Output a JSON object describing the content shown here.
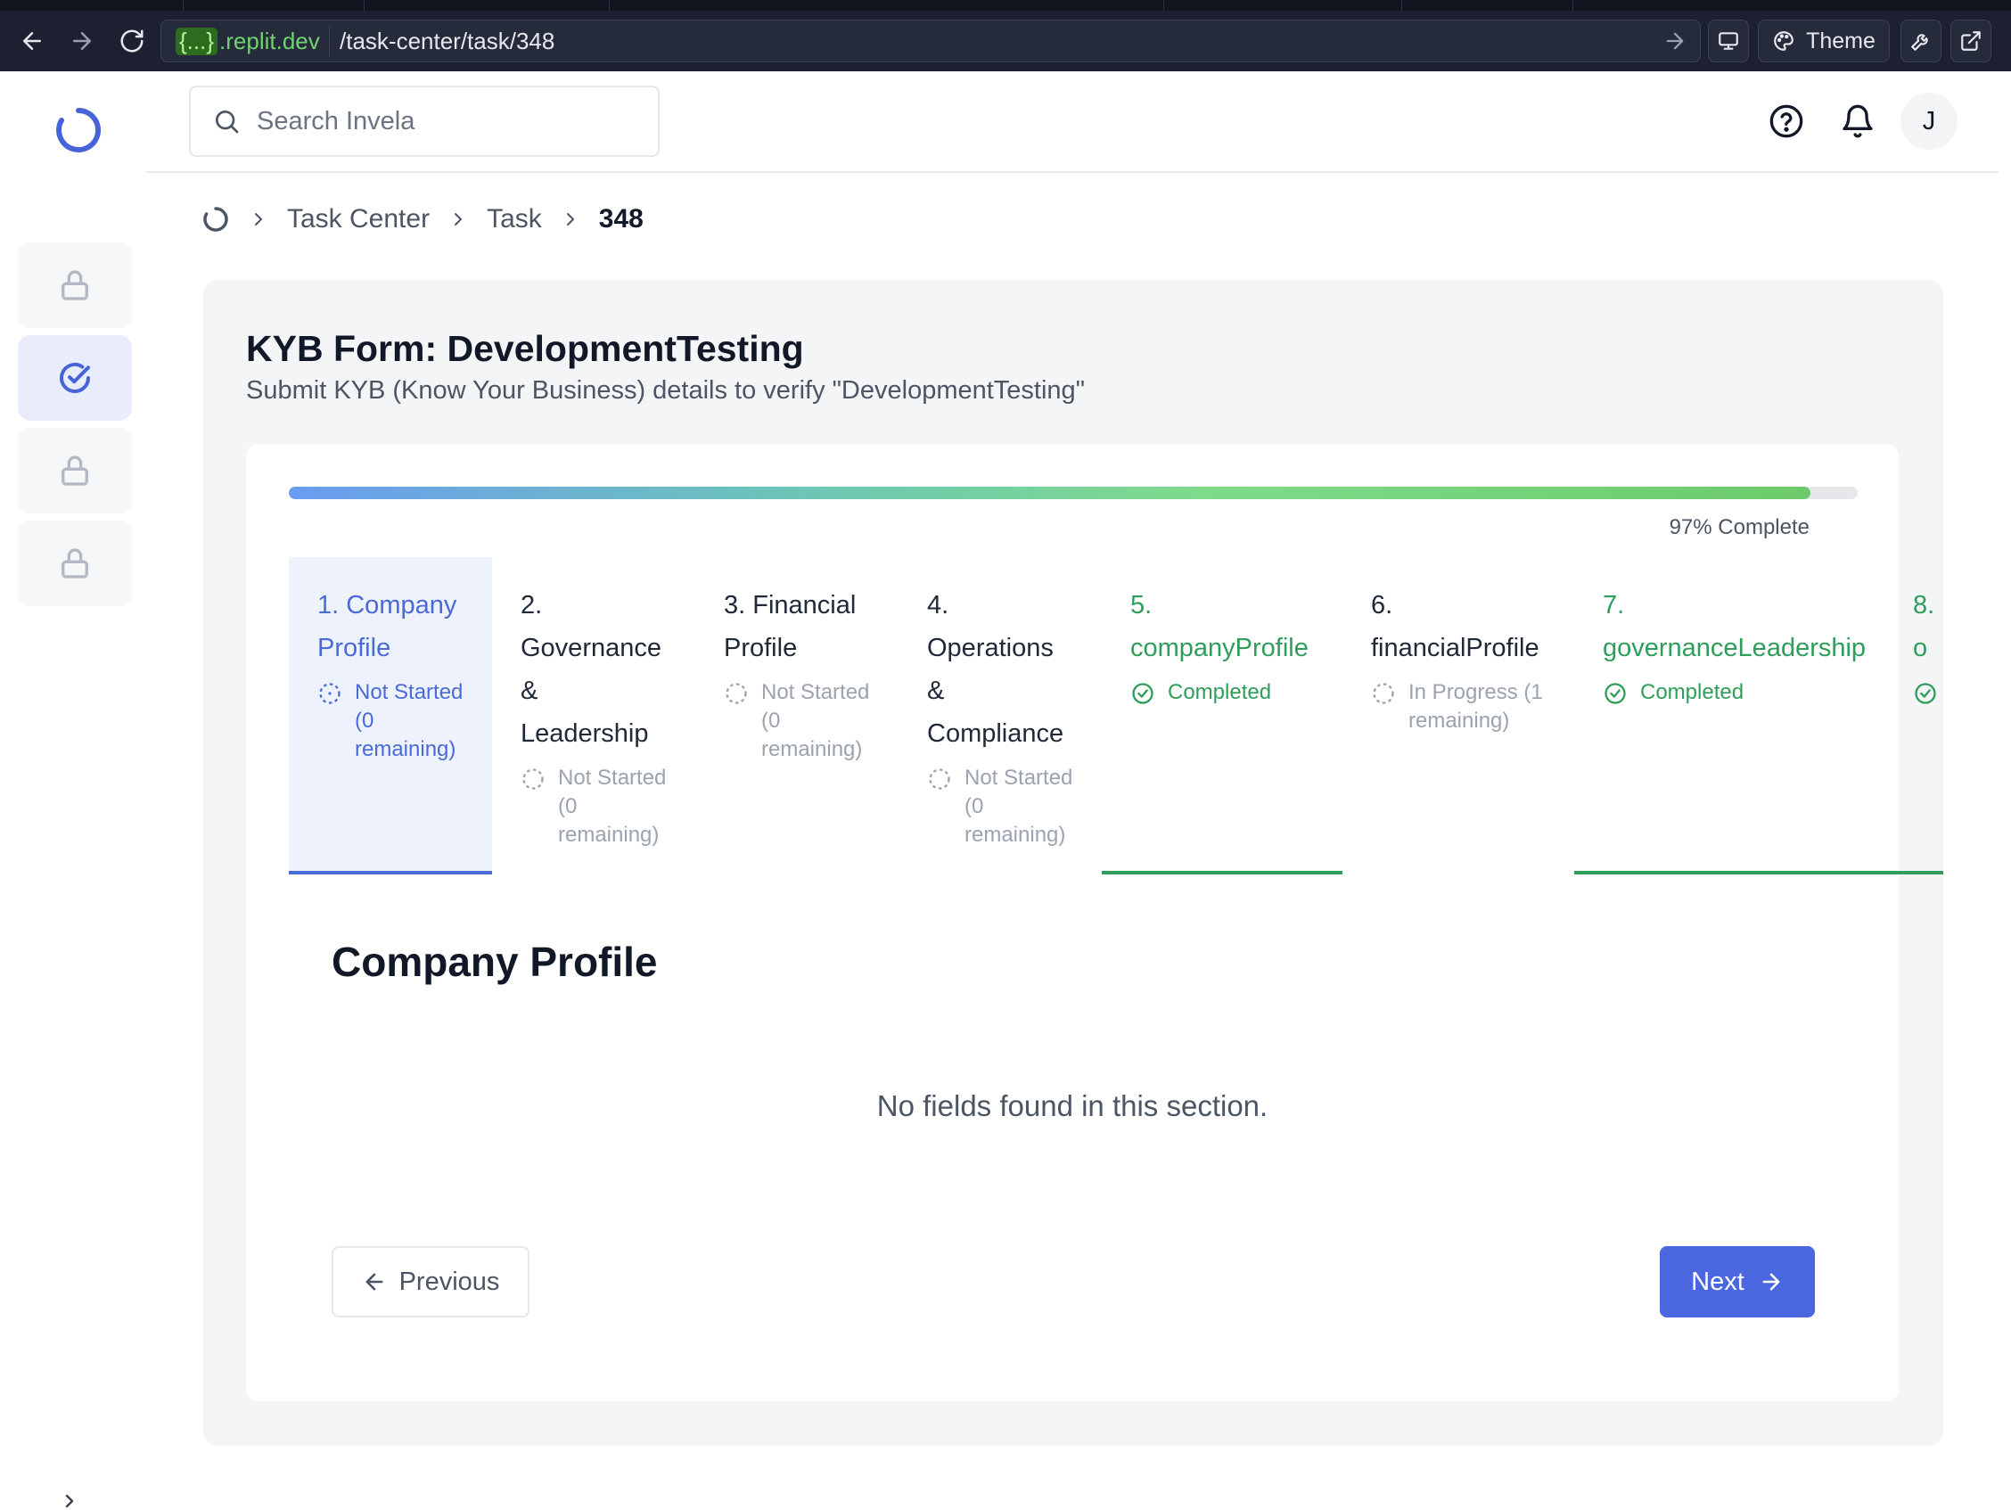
{
  "browser": {
    "url_host_braces": "{...}",
    "url_host_domain": ".replit.dev",
    "url_path": "/task-center/task/348",
    "theme_label": "Theme"
  },
  "header": {
    "search_placeholder": "Search Invela",
    "avatar_initial": "J"
  },
  "breadcrumb": {
    "items": [
      "Task Center",
      "Task",
      "348"
    ]
  },
  "form": {
    "title": "KYB Form: DevelopmentTesting",
    "subtitle": "Submit KYB (Know Your Business) details to verify \"DevelopmentTesting\"",
    "progress_percent": 97,
    "progress_label": "97% Complete"
  },
  "tabs": [
    {
      "title": "1. Company Profile",
      "status": "Not Started (0 remaining)",
      "state": "active"
    },
    {
      "title": "2. Governance & Leadership",
      "status": "Not Started (0 remaining)",
      "state": "not-started"
    },
    {
      "title": "3. Financial Profile",
      "status": "Not Started (0 remaining)",
      "state": "not-started"
    },
    {
      "title": "4. Operations & Compliance",
      "status": "Not Started (0 remaining)",
      "state": "not-started"
    },
    {
      "title": "5. companyProfile",
      "status": "Completed",
      "state": "completed"
    },
    {
      "title": "6. financialProfile",
      "status": "In Progress (1 remaining)",
      "state": "in-progress"
    },
    {
      "title": "7. governanceLeadership",
      "status": "Completed",
      "state": "completed"
    },
    {
      "title": "8. o",
      "status": "",
      "state": "completed"
    }
  ],
  "section": {
    "title": "Company Profile",
    "empty_message": "No fields found in this section."
  },
  "buttons": {
    "previous": "Previous",
    "next": "Next"
  },
  "colors": {
    "accent": "#4a67e0",
    "completed": "#2f9e5b",
    "muted": "#9ca3af"
  }
}
